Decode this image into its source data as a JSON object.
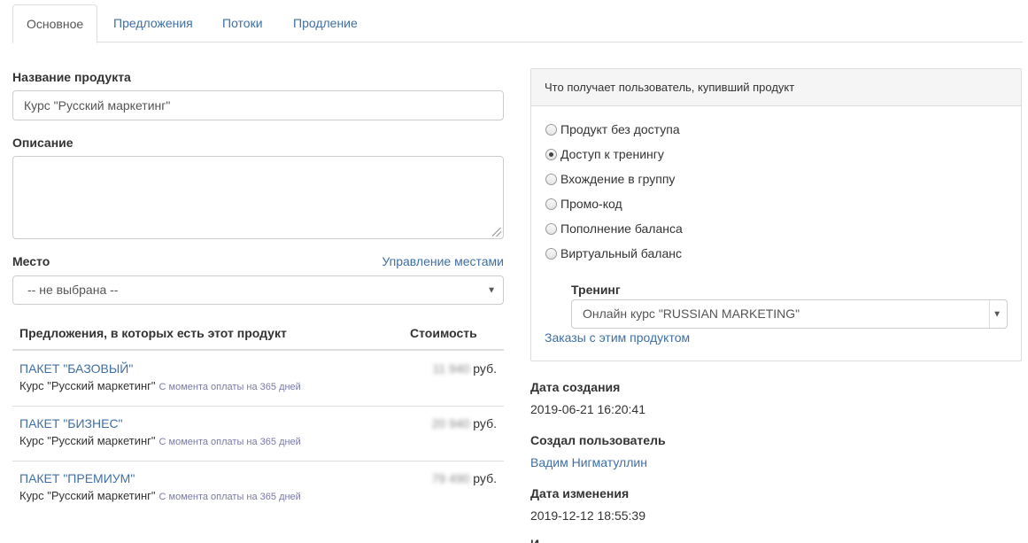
{
  "tabs": [
    {
      "label": "Основное",
      "active": true
    },
    {
      "label": "Предложения",
      "active": false
    },
    {
      "label": "Потоки",
      "active": false
    },
    {
      "label": "Продление",
      "active": false
    }
  ],
  "form": {
    "name_label": "Название продукта",
    "name_value": "Курс \"Русский маркетинг\"",
    "description_label": "Описание",
    "description_value": "",
    "place_label": "Место",
    "place_manage_link": "Управление местами",
    "place_value": "-- не выбрана --"
  },
  "offers_table": {
    "headers": [
      "Предложения, в которых есть этот продукт",
      "Стоимость"
    ],
    "rows": [
      {
        "name": "ПАКЕТ \"БАЗОВЫЙ\"",
        "desc": "Курс \"Русский маркетинг\"",
        "term": "С момента оплаты на 365 дней",
        "price": "11 940",
        "currency": "руб."
      },
      {
        "name": "ПАКЕТ \"БИЗНЕС\"",
        "desc": "Курс \"Русский маркетинг\"",
        "term": "С момента оплаты на 365 дней",
        "price": "20 940",
        "currency": "руб."
      },
      {
        "name": "ПАКЕТ \"ПРЕМИУМ\"",
        "desc": "Курс \"Русский маркетинг\"",
        "term": "С момента оплаты на 365 дней",
        "price": "79 490",
        "currency": "руб."
      }
    ]
  },
  "access_panel": {
    "heading": "Что получает пользователь, купивший продукт",
    "options": [
      {
        "label": "Продукт без доступа",
        "checked": false
      },
      {
        "label": "Доступ к тренингу",
        "checked": true
      },
      {
        "label": "Вхождение в группу",
        "checked": false
      },
      {
        "label": "Промо-код",
        "checked": false
      },
      {
        "label": "Пополнение баланса",
        "checked": false
      },
      {
        "label": "Виртуальный баланс",
        "checked": false
      }
    ],
    "training_label": "Тренинг",
    "training_value": "Онлайн курс \"RUSSIAN MARKETING\"",
    "orders_link": "Заказы с этим продуктом"
  },
  "meta": {
    "created_label": "Дата создания",
    "created_value": "2019-06-21 16:20:41",
    "creator_label": "Создал пользователь",
    "creator_value": "Вадим Нигматуллин",
    "modified_label": "Дата изменения",
    "modified_value": "2019-12-12 18:55:39",
    "next_label": "И"
  }
}
